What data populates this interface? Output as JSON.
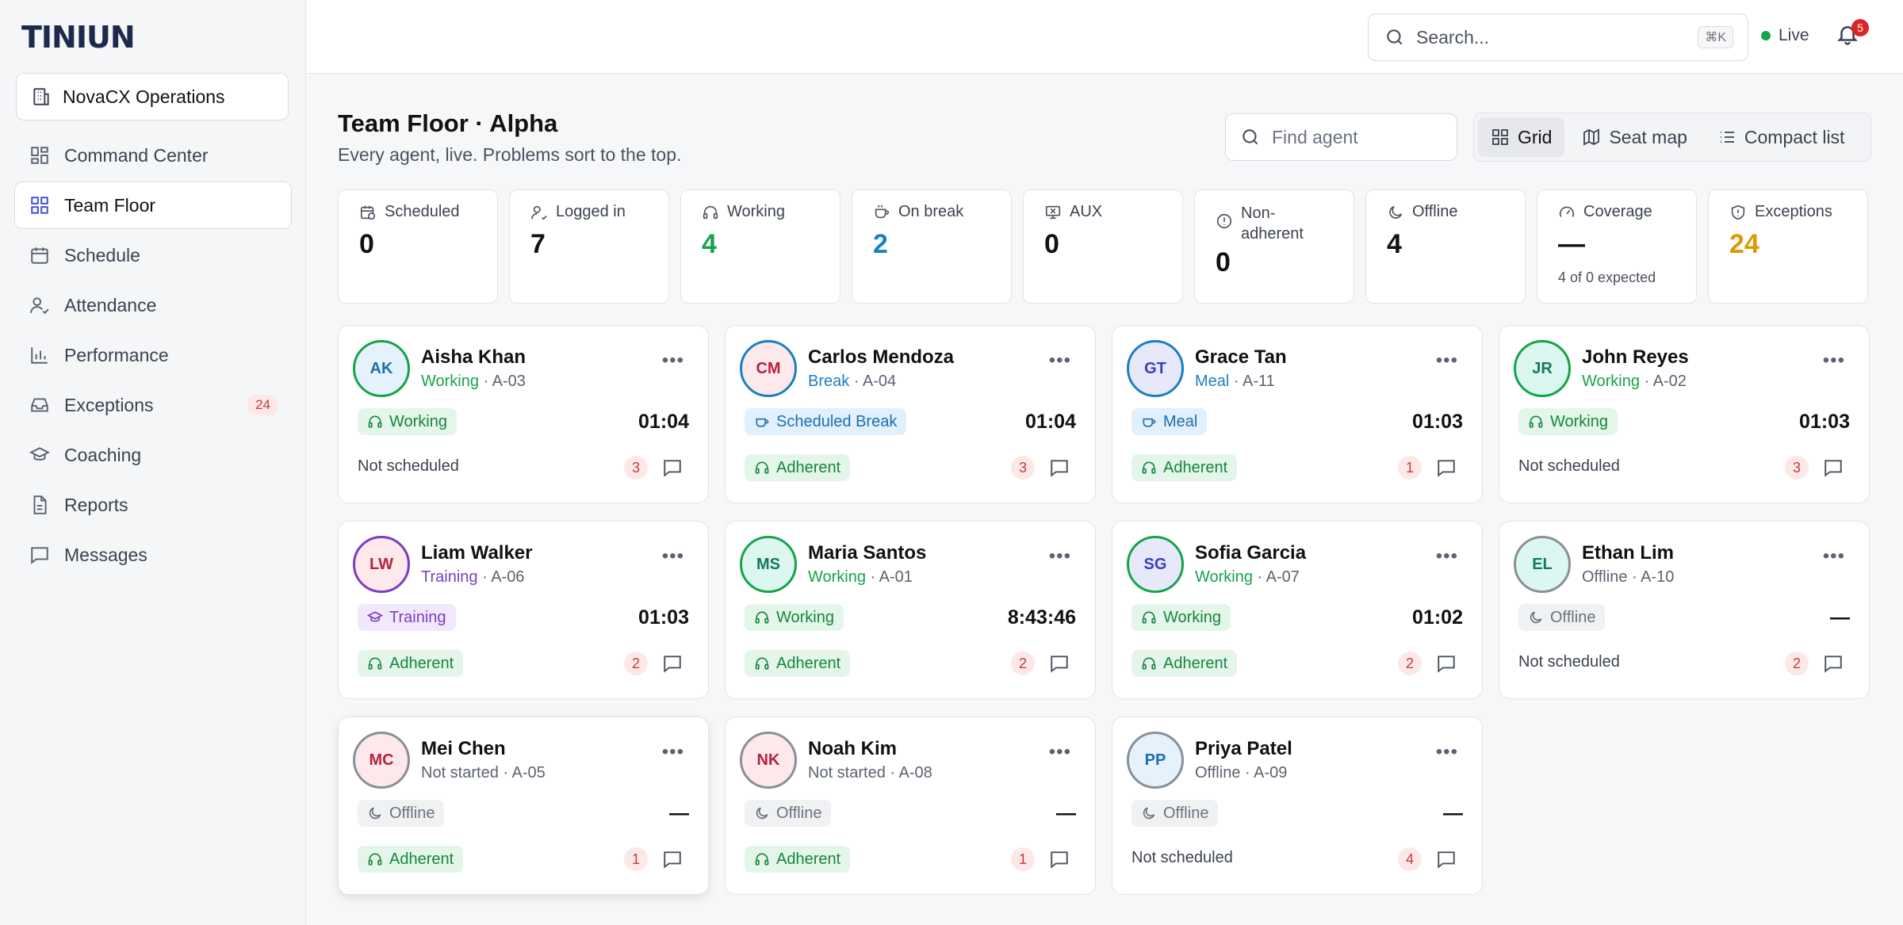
{
  "brand": {
    "logo_text": "TINIUN"
  },
  "sidebar": {
    "org": "NovaCX Operations",
    "items": [
      {
        "label": "Command Center",
        "icon": "grid-icon"
      },
      {
        "label": "Team Floor",
        "icon": "grid-icon",
        "active": true
      },
      {
        "label": "Schedule",
        "icon": "calendar-icon"
      },
      {
        "label": "Attendance",
        "icon": "user-check-icon"
      },
      {
        "label": "Performance",
        "icon": "bar-chart-icon"
      },
      {
        "label": "Exceptions",
        "icon": "inbox-icon",
        "badge": "24"
      },
      {
        "label": "Coaching",
        "icon": "graduation-cap-icon"
      },
      {
        "label": "Reports",
        "icon": "file-icon"
      },
      {
        "label": "Messages",
        "icon": "message-icon"
      }
    ]
  },
  "topbar": {
    "search_placeholder": "Search...",
    "shortcut": "⌘K",
    "live_label": "Live",
    "notifications": "5"
  },
  "page": {
    "title": "Team Floor · Alpha",
    "subtitle": "Every agent, live. Problems sort to the top.",
    "find_placeholder": "Find agent",
    "views": [
      "Grid",
      "Seat map",
      "Compact list"
    ]
  },
  "stats": [
    {
      "label": "Scheduled",
      "value": "0"
    },
    {
      "label": "Logged in",
      "value": "7"
    },
    {
      "label": "Working",
      "value": "4"
    },
    {
      "label": "On break",
      "value": "2"
    },
    {
      "label": "AUX",
      "value": "0"
    },
    {
      "label": "Non-adherent",
      "value": "0"
    },
    {
      "label": "Offline",
      "value": "4"
    },
    {
      "label": "Coverage",
      "value": "—",
      "sub": "4 of 0 expected"
    },
    {
      "label": "Exceptions",
      "value": "24"
    }
  ],
  "agents": [
    {
      "initials": "AK",
      "name": "Aisha Khan",
      "state": "Working",
      "seat": "A-03",
      "status_pill": "Working",
      "timer": "01:04",
      "adherence": "Not scheduled",
      "count": "3"
    },
    {
      "initials": "CM",
      "name": "Carlos Mendoza",
      "state": "Break",
      "seat": "A-04",
      "status_pill": "Scheduled Break",
      "timer": "01:04",
      "adherence": "Adherent",
      "count": "3"
    },
    {
      "initials": "GT",
      "name": "Grace Tan",
      "state": "Meal",
      "seat": "A-11",
      "status_pill": "Meal",
      "timer": "01:03",
      "adherence": "Adherent",
      "count": "1"
    },
    {
      "initials": "JR",
      "name": "John Reyes",
      "state": "Working",
      "seat": "A-02",
      "status_pill": "Working",
      "timer": "01:03",
      "adherence": "Not scheduled",
      "count": "3"
    },
    {
      "initials": "LW",
      "name": "Liam Walker",
      "state": "Training",
      "seat": "A-06",
      "status_pill": "Training",
      "timer": "01:03",
      "adherence": "Adherent",
      "count": "2"
    },
    {
      "initials": "MS",
      "name": "Maria Santos",
      "state": "Working",
      "seat": "A-01",
      "status_pill": "Working",
      "timer": "8:43:46",
      "adherence": "Adherent",
      "count": "2"
    },
    {
      "initials": "SG",
      "name": "Sofia Garcia",
      "state": "Working",
      "seat": "A-07",
      "status_pill": "Working",
      "timer": "01:02",
      "adherence": "Adherent",
      "count": "2"
    },
    {
      "initials": "EL",
      "name": "Ethan Lim",
      "state": "Offline",
      "seat": "A-10",
      "status_pill": "Offline",
      "timer": "—",
      "adherence": "Not scheduled",
      "count": "2"
    },
    {
      "initials": "MC",
      "name": "Mei Chen",
      "state": "Not started",
      "seat": "A-05",
      "status_pill": "Offline",
      "timer": "—",
      "adherence": "Adherent",
      "count": "1"
    },
    {
      "initials": "NK",
      "name": "Noah Kim",
      "state": "Not started",
      "seat": "A-08",
      "status_pill": "Offline",
      "timer": "—",
      "adherence": "Adherent",
      "count": "1"
    },
    {
      "initials": "PP",
      "name": "Priya Patel",
      "state": "Offline",
      "seat": "A-09",
      "status_pill": "Offline",
      "timer": "—",
      "adherence": "Not scheduled",
      "count": "4"
    }
  ],
  "colors": {
    "working": "#16a34a",
    "break": "#1d7fc1",
    "training": "#7a3ec2",
    "offline": "#6b7280",
    "exceptions": "#d99a06",
    "accent": "#3b4fd6"
  }
}
